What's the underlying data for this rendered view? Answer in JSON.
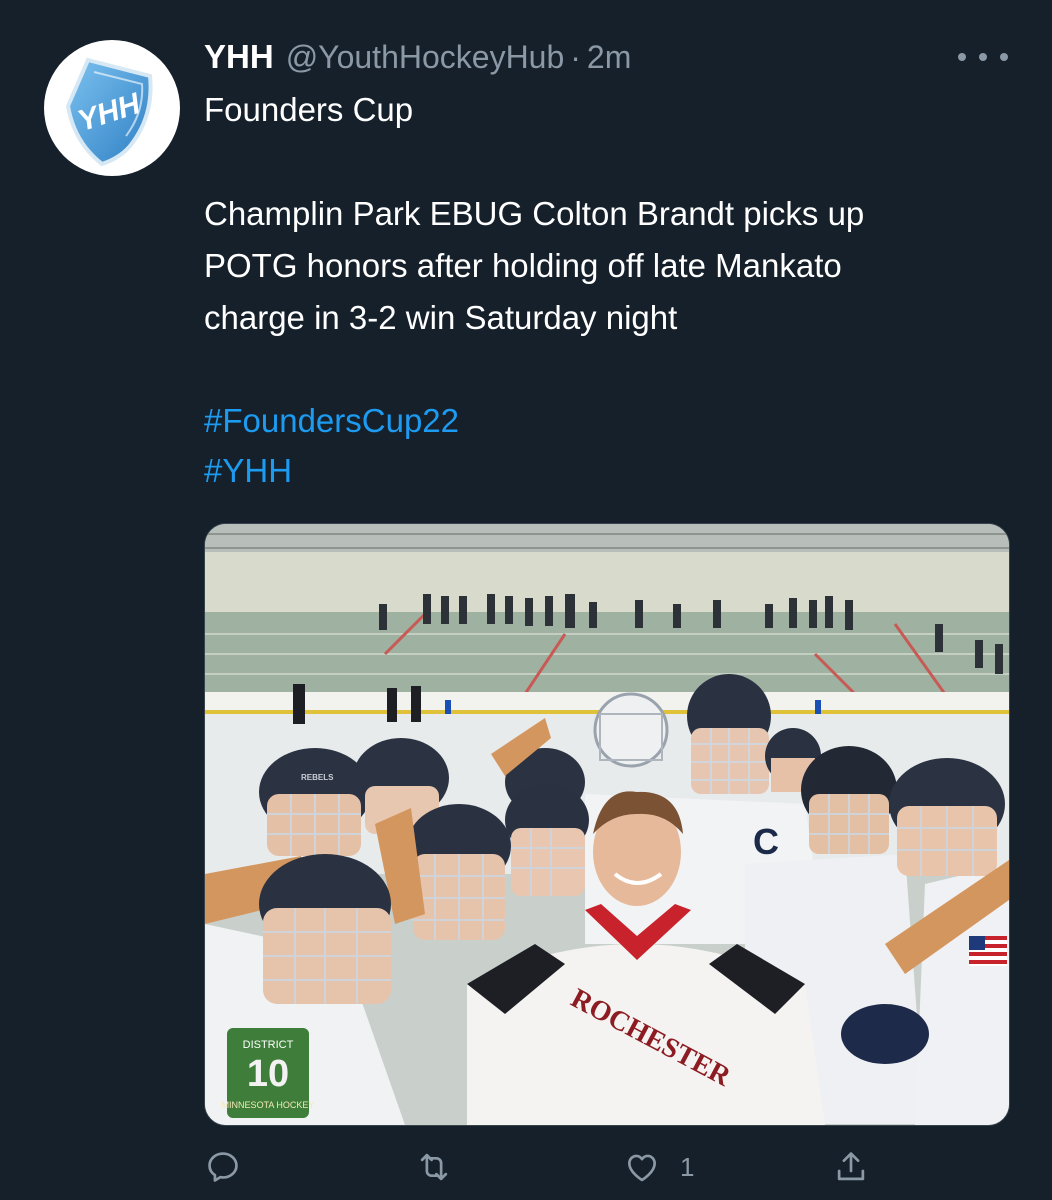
{
  "tweet": {
    "display_name": "YHH",
    "handle": "@YouthHockeyHub",
    "separator": "·",
    "timestamp": "2m",
    "avatar_text": "YHH",
    "text_lines": [
      "Founders Cup",
      "Champlin Park EBUG Colton Brandt picks up",
      "POTG honors after holding off late Mankato",
      "charge in 3-2 win Saturday night"
    ],
    "hashtags": [
      "#FoundersCup22",
      "#YHH"
    ],
    "media": {
      "jersey_text": "ROCHESTER",
      "helmet_text": "REBELS",
      "patch_text_top": "DISTRICT",
      "patch_number": "10",
      "patch_text_bottom": "MINNESOTA HOCKEY"
    }
  },
  "actions": {
    "reply": {
      "icon": "reply-icon",
      "count": ""
    },
    "retweet": {
      "icon": "retweet-icon",
      "count": ""
    },
    "like": {
      "icon": "heart-icon",
      "count": "1"
    },
    "share": {
      "icon": "share-icon",
      "count": ""
    }
  },
  "colors": {
    "background": "#15202b",
    "text": "#ffffff",
    "secondary": "#8b98a5",
    "link": "#1d9bf0",
    "avatar_blue": "#3a95d8"
  }
}
